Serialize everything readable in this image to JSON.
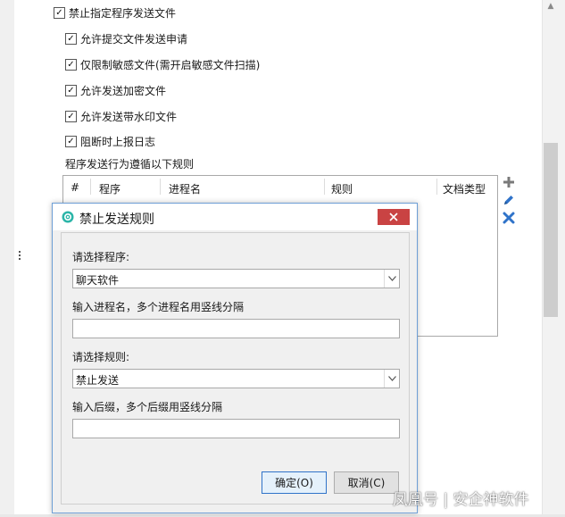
{
  "options": {
    "block_program_send": {
      "label": "禁止指定程序发送文件",
      "checked": true
    },
    "allow_request": {
      "label": "允许提交文件发送申请",
      "checked": true
    },
    "sensitive_only": {
      "label": "仅限制敏感文件(需开启敏感文件扫描)",
      "checked": true
    },
    "allow_encrypted": {
      "label": "允许发送加密文件",
      "checked": true
    },
    "allow_watermark": {
      "label": "允许发送带水印文件",
      "checked": true
    },
    "report_log": {
      "label": "阻断时上报日志",
      "checked": true
    }
  },
  "rules_caption": "程序发送行为遵循以下规则",
  "rules_table": {
    "columns": [
      "#",
      "程序",
      "进程名",
      "规则",
      "文档类型"
    ]
  },
  "dialog": {
    "title": "禁止发送规则",
    "program_label": "请选择程序:",
    "program_value": "聊天软件",
    "process_label": "输入进程名，多个进程名用竖线分隔",
    "process_value": "",
    "rule_label": "请选择规则:",
    "rule_value": "禁止发送",
    "suffix_label": "输入后缀，多个后缀用竖线分隔",
    "suffix_value": "",
    "ok_label": "确定(O)",
    "cancel_label": "取消(C)"
  },
  "watermark": "凤凰号 | 安企神软件",
  "icons": {
    "add": "plus-icon",
    "edit": "pencil-icon",
    "delete": "x-icon",
    "close": "close-icon",
    "dialog": "shield-icon"
  },
  "colors": {
    "close_button": "#c94343",
    "edit_icon": "#2f73c9",
    "delete_icon": "#2f73c9",
    "dialog_border": "#6e9fd6"
  }
}
